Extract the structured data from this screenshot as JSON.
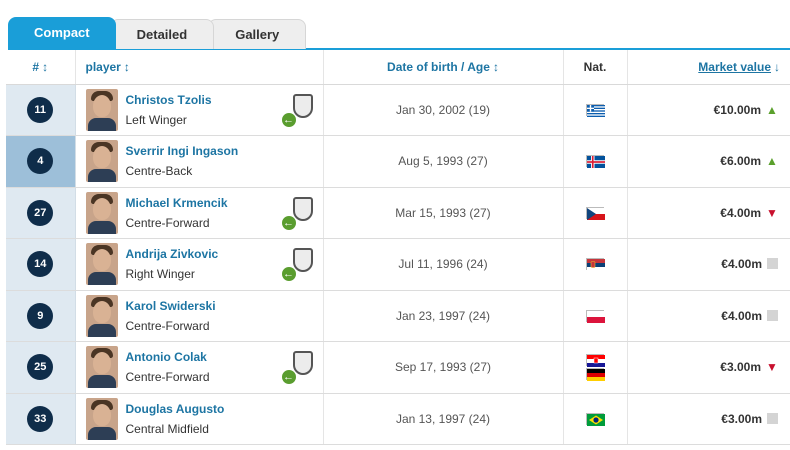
{
  "tabs": [
    {
      "label": "Compact",
      "active": true
    },
    {
      "label": "Detailed",
      "active": false
    },
    {
      "label": "Gallery",
      "active": false
    }
  ],
  "header": {
    "num": "#",
    "player": "player",
    "dob": "Date of birth / Age",
    "nat": "Nat.",
    "market_value": "Market value",
    "sort_icon": "↕",
    "sort_desc_icon": "↓"
  },
  "players": [
    {
      "number": "11",
      "name": "Christos Tzolis",
      "position": "Left Winger",
      "dob": "Jan 30, 2002 (19)",
      "market_value": "€10.00m",
      "trend": "up",
      "highlight": false,
      "has_club": true,
      "nationalities": [
        "Greece"
      ]
    },
    {
      "number": "4",
      "name": "Sverrir Ingi Ingason",
      "position": "Centre-Back",
      "dob": "Aug 5, 1993 (27)",
      "market_value": "€6.00m",
      "trend": "up",
      "highlight": true,
      "has_club": false,
      "nationalities": [
        "Iceland"
      ]
    },
    {
      "number": "27",
      "name": "Michael Krmencik",
      "position": "Centre-Forward",
      "dob": "Mar 15, 1993 (27)",
      "market_value": "€4.00m",
      "trend": "down",
      "highlight": false,
      "has_club": true,
      "nationalities": [
        "Czech Republic"
      ]
    },
    {
      "number": "14",
      "name": "Andrija Zivkovic",
      "position": "Right Winger",
      "dob": "Jul 11, 1996 (24)",
      "market_value": "€4.00m",
      "trend": "flat",
      "highlight": false,
      "has_club": true,
      "nationalities": [
        "Serbia"
      ]
    },
    {
      "number": "9",
      "name": "Karol Swiderski",
      "position": "Centre-Forward",
      "dob": "Jan 23, 1997 (24)",
      "market_value": "€4.00m",
      "trend": "flat",
      "highlight": false,
      "has_club": false,
      "nationalities": [
        "Poland"
      ]
    },
    {
      "number": "25",
      "name": "Antonio Colak",
      "position": "Centre-Forward",
      "dob": "Sep 17, 1993 (27)",
      "market_value": "€3.00m",
      "trend": "down",
      "highlight": false,
      "has_club": true,
      "nationalities": [
        "Croatia",
        "Germany"
      ]
    },
    {
      "number": "33",
      "name": "Douglas Augusto",
      "position": "Central Midfield",
      "dob": "Jan 13, 1997 (24)",
      "market_value": "€3.00m",
      "trend": "flat",
      "highlight": false,
      "has_club": false,
      "nationalities": [
        "Brazil"
      ]
    }
  ],
  "icons": {
    "trend_up": "▲",
    "trend_down": "▼",
    "transfer_arrow": "←"
  },
  "colors": {
    "accent": "#1a9ed8",
    "link": "#1d75a3",
    "badge": "#0f2d4a",
    "highlight_row": "#9dbfd9",
    "up": "#5aa02c",
    "down": "#c8102e"
  }
}
